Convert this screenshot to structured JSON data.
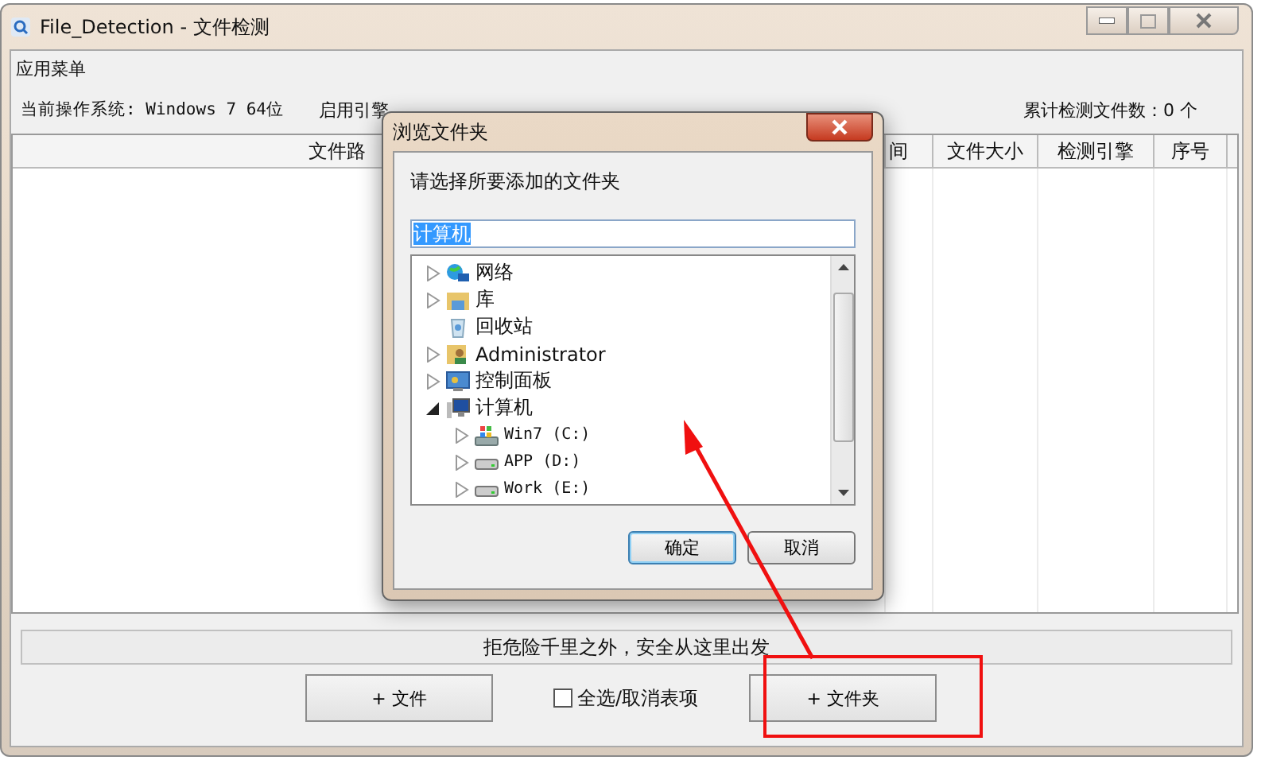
{
  "window": {
    "title": "File_Detection - 文件检测"
  },
  "menu": {
    "label": "应用菜单"
  },
  "info": {
    "os": "当前操作系统: Windows 7 64位",
    "engine": "启用引擎",
    "count": "累计检测文件数：0 个"
  },
  "table": {
    "columns": [
      {
        "label": "文件路"
      },
      {
        "label": "间"
      },
      {
        "label": "文件大小"
      },
      {
        "label": "检测引擎"
      },
      {
        "label": "序号"
      }
    ]
  },
  "status_bar": {
    "text": "拒危险千里之外，安全从这里出发"
  },
  "buttons": [
    {
      "kind": "button",
      "label": "+ 文件"
    },
    {
      "kind": "checkbox",
      "label": "全选/取消表项",
      "checked": false
    },
    {
      "kind": "button",
      "label": "+ 文件夹"
    }
  ],
  "dialog": {
    "title": "浏览文件夹",
    "prompt": "请选择所要添加的文件夹",
    "field_value": "计算机",
    "tree": [
      {
        "kind": "network",
        "label": "网络",
        "expandable": true,
        "expanded": false
      },
      {
        "kind": "library",
        "label": "库",
        "expandable": true,
        "expanded": false
      },
      {
        "kind": "recycle",
        "label": "回收站",
        "expandable": false
      },
      {
        "kind": "user",
        "label": "Administrator",
        "expandable": true,
        "expanded": false
      },
      {
        "kind": "control-panel",
        "label": "控制面板",
        "expandable": true,
        "expanded": false
      },
      {
        "kind": "computer",
        "label": "计算机",
        "expandable": true,
        "expanded": true,
        "children": [
          {
            "kind": "system-drive",
            "label": "Win7 (C:)",
            "expandable": true,
            "expanded": false
          },
          {
            "kind": "drive",
            "label": "APP (D:)",
            "expandable": true,
            "expanded": false
          },
          {
            "kind": "drive",
            "label": "Work (E:)",
            "expandable": true,
            "expanded": false
          }
        ]
      }
    ],
    "buttons": [
      {
        "label": "确定",
        "default": true
      },
      {
        "label": "取消",
        "default": false
      }
    ]
  },
  "annotation": {
    "arrow": true,
    "highlight_box": true
  }
}
